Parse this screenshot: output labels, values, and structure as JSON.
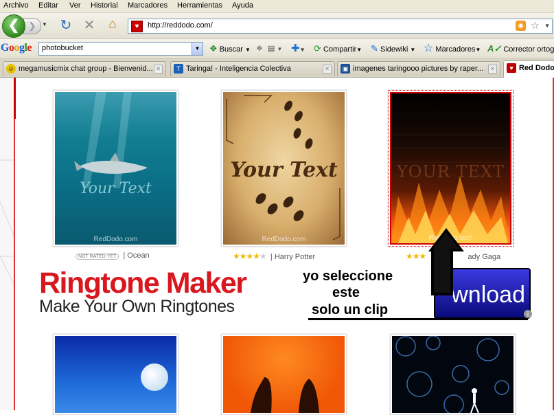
{
  "menu": [
    "Archivo",
    "Editar",
    "Ver",
    "Historial",
    "Marcadores",
    "Herramientas",
    "Ayuda"
  ],
  "nav": {
    "url": "http://reddodo.com/"
  },
  "google_toolbar": {
    "logo": "Google",
    "search_value": "photobucket",
    "buscar": "Buscar",
    "compartir": "Compartir",
    "sidewiki": "Sidewiki",
    "marcadores": "Marcadores",
    "corrector": "Corrector ortog"
  },
  "tabs": [
    {
      "label": "megamusicmix chat group - Bienvenid...",
      "icon_color": "#e8c200"
    },
    {
      "label": "Taringa! - Inteligencia Colectiva",
      "icon_color": "#1a62b8"
    },
    {
      "label": "imagenes taringooo pictures by raper...",
      "icon_color": "#1c4f99"
    },
    {
      "label": "Red Dodo",
      "icon_color": "#c00000"
    }
  ],
  "cards_row1": [
    {
      "overlay": "Your Text",
      "brand": "RedDodo.com",
      "rating_badge": "NOT RATED YET",
      "title": "Ocean",
      "rating": null
    },
    {
      "overlay": "Your Text",
      "brand": "RedDodo.com",
      "title": "Harry Potter",
      "rating": 4.5
    },
    {
      "overlay": "YOUR TEXT",
      "brand": "RedDodo.com",
      "title": "Lady Gaga",
      "title_visible": "ady Gaga",
      "rating": 3
    }
  ],
  "ad": {
    "headline": "Ringtone Maker",
    "subline": "Make Your Own Ringtones",
    "button": "wnload",
    "info": "i"
  },
  "annotation": {
    "line1": "yo seleccione",
    "line2": "este",
    "line3": "solo un clip"
  },
  "colors": {
    "accent_red": "#d8171e",
    "chrome": "#ece9d8",
    "download_blue": "#1a1aa8"
  },
  "icons": [
    "back-arrow-icon",
    "forward-arrow-icon",
    "reload-icon",
    "stop-icon",
    "home-icon",
    "rss-icon",
    "bookmark-star-icon",
    "google-search-icon",
    "share-icon",
    "sidewiki-icon",
    "bookmarks-star-icon",
    "spellcheck-icon",
    "tab-close-icon",
    "up-arrow-annotation-icon"
  ]
}
